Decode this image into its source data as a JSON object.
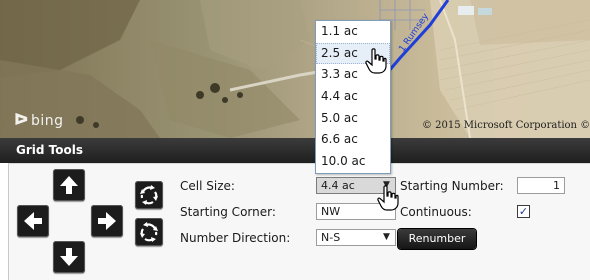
{
  "map": {
    "attribution_logo": "bing",
    "copyright": "© 2015 Microsoft Corporation ©",
    "road_label": "1 Rumsey"
  },
  "panel": {
    "title": "Grid Tools"
  },
  "nav_buttons": [
    {
      "name": "arrow-up-icon",
      "direction": "up"
    },
    {
      "name": "arrow-left-icon",
      "direction": "left"
    },
    {
      "name": "arrow-right-icon",
      "direction": "right"
    },
    {
      "name": "arrow-down-icon",
      "direction": "down"
    }
  ],
  "rotate_buttons": [
    "rotate-clockwise-icon",
    "rotate-counterclockwise-icon"
  ],
  "form": {
    "cell_size": {
      "label": "Cell Size:",
      "value": "4.4 ac"
    },
    "starting_corner": {
      "label": "Starting Corner:",
      "value": "NW"
    },
    "number_direction": {
      "label": "Number Direction:",
      "value": "N-S"
    },
    "starting_number": {
      "label": "Starting Number:",
      "value": "1"
    },
    "continuous": {
      "label": "Continuous:",
      "checked": true,
      "check_glyph": "✓"
    },
    "renumber_label": "Renumber"
  },
  "cell_size_dropdown": {
    "options": [
      "1.1 ac",
      "2.5 ac",
      "3.3 ac",
      "4.4 ac",
      "5.0 ac",
      "6.6 ac",
      "10.0 ac"
    ],
    "hovered": "2.5 ac"
  },
  "colors": {
    "panel_header": "#2b2b2b",
    "button_dark": "#1c1c1c",
    "road_blue": "#1f3fd8",
    "dropdown_border": "#7f9db9"
  }
}
